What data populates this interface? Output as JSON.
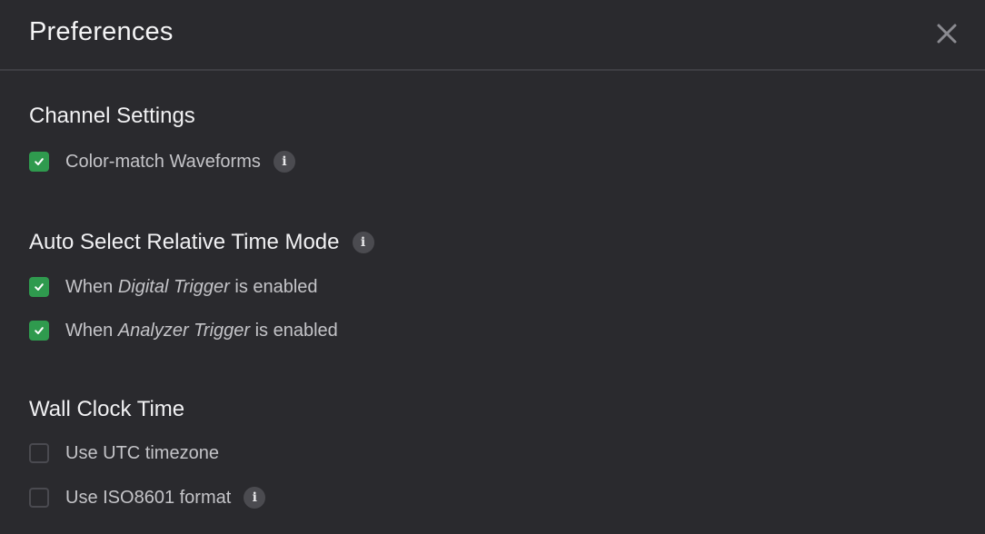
{
  "dialog": {
    "title": "Preferences",
    "close_icon": "close-icon"
  },
  "sections": {
    "channel": {
      "title": "Channel Settings",
      "items": [
        {
          "label": "Color-match Waveforms",
          "checked": true,
          "info": true
        }
      ]
    },
    "relative_time": {
      "title": "Auto Select Relative Time Mode",
      "info": true,
      "items": [
        {
          "prefix": "When ",
          "emphasis": "Digital Trigger",
          "suffix": " is enabled",
          "checked": true
        },
        {
          "prefix": "When ",
          "emphasis": "Analyzer Trigger",
          "suffix": " is enabled",
          "checked": true
        }
      ]
    },
    "wall_clock": {
      "title": "Wall Clock Time",
      "items": [
        {
          "label": "Use UTC timezone",
          "checked": false
        },
        {
          "label": "Use ISO8601 format",
          "checked": false,
          "info": true
        }
      ]
    }
  },
  "info_glyph": "i",
  "colors": {
    "background": "#2a2a2e",
    "checkbox_checked": "#2f9a4e",
    "info_badge": "#4b4b50",
    "divider": "#3e3e43"
  }
}
